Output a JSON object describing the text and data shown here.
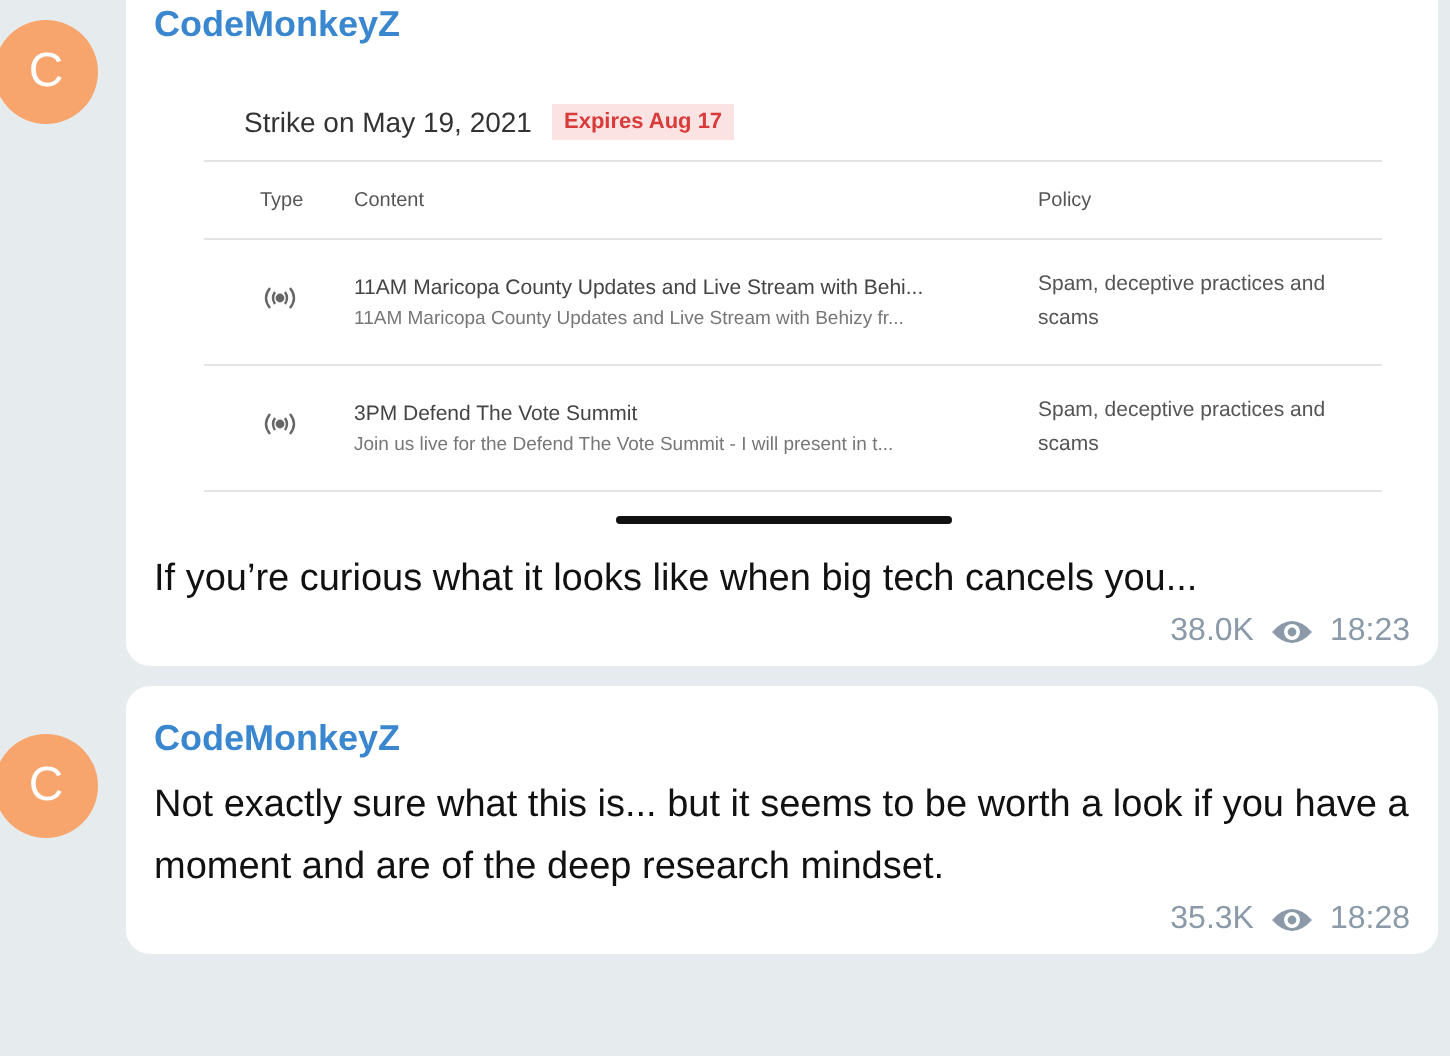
{
  "messages": [
    {
      "author": "CodeMonkeyZ",
      "avatar": "C",
      "attachment": {
        "heading": "Strike on May 19, 2021",
        "badge": "Expires Aug 17",
        "columns": [
          "Type",
          "Content",
          "Policy"
        ],
        "rows": [
          {
            "kind": "live",
            "title": "11AM Maricopa County Updates and Live Stream with Behi...",
            "subtitle": "11AM Maricopa County Updates and Live Stream with Behizy fr...",
            "policy": "Spam, deceptive practices and scams"
          },
          {
            "kind": "live",
            "title": "3PM Defend The Vote Summit",
            "subtitle": "Join us live for the Defend The Vote Summit - I will present in t...",
            "policy": "Spam, deceptive practices and scams"
          }
        ]
      },
      "text": "If you’re curious what it looks like when big tech cancels you...",
      "views": "38.0K",
      "time": "18:23"
    },
    {
      "author": "CodeMonkeyZ",
      "avatar": "C",
      "text": "Not exactly sure what this is... but it seems to be worth a look if you have a moment and are of the deep research mindset.",
      "views": "35.3K",
      "time": "18:28"
    }
  ]
}
